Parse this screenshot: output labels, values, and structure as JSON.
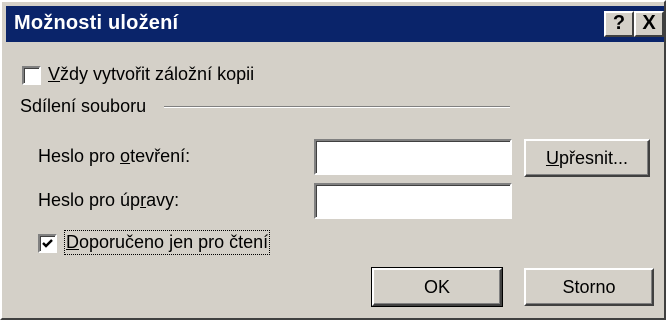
{
  "window": {
    "title": "Možnosti uložení",
    "help_glyph": "?",
    "close_glyph": "X"
  },
  "options": {
    "backup": {
      "label_underlined": "V",
      "label_rest": "ždy vytvořit záložní kopii",
      "checked": false
    }
  },
  "sharing": {
    "group_label": "Sdílení souboru",
    "open_password": {
      "label_before": "Heslo pro ",
      "label_underlined": "o",
      "label_after": "tevření:",
      "value": ""
    },
    "modify_password": {
      "label_before": "Heslo pro úp",
      "label_underlined": "r",
      "label_after": "avy:",
      "value": ""
    },
    "readonly": {
      "label_underlined": "D",
      "label_rest": "oporučeno jen pro čtení",
      "checked": true
    },
    "advanced_button": {
      "label_underlined": "U",
      "label_rest": "přesnit..."
    }
  },
  "buttons": {
    "ok": "OK",
    "cancel": "Storno"
  }
}
